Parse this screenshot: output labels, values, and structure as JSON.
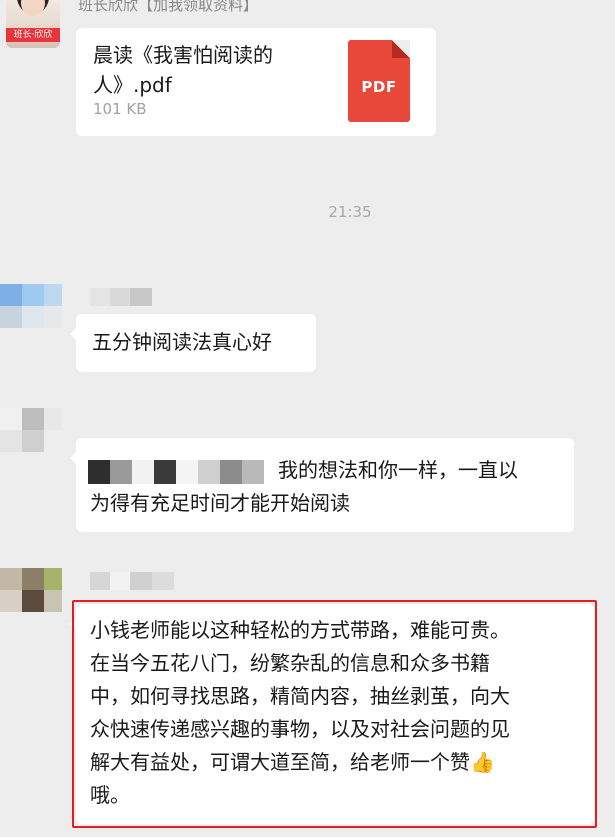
{
  "messages": [
    {
      "sender": "班长欣欣【加我领取资料】",
      "avatar_badge": "班长·欣欣",
      "type": "file",
      "file_name": "晨读《我害怕阅读的人》.pdf",
      "file_size": "101 KB",
      "file_type": "PDF"
    },
    {
      "type": "timestamp",
      "text": "21:35"
    },
    {
      "type": "text",
      "text": "五分钟阅读法真心好"
    },
    {
      "type": "text",
      "text_line1": "我的想法和你一样，一直以",
      "text_line2": "为得有充足时间才能开始阅读"
    },
    {
      "type": "text",
      "highlighted": true,
      "lines": [
        "小钱老师能以这种轻松的方式带路，难能可贵。",
        "在当今五花八门，纷繁杂乱的信息和众多书籍",
        "中，如何寻找思路，精简内容，抽丝剥茧，向大",
        "众快速传递感兴趣的事物，以及对社会问题的见",
        "解大有益处，可谓大道至简，给老师一个赞👍",
        "哦。"
      ]
    }
  ],
  "colors": {
    "background": "#ededed",
    "bubble": "#ffffff",
    "pdf_icon": "#e9473a",
    "highlight_border": "#e02020"
  },
  "icons": {
    "file": "pdf-file-icon",
    "emoji": "thumbs-up-emoji"
  }
}
